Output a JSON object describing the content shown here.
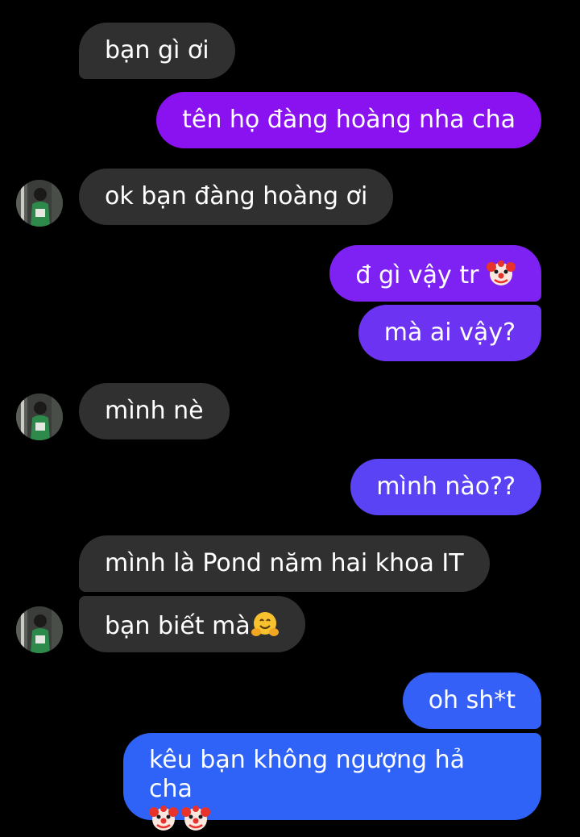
{
  "conversation": {
    "messages": [
      {
        "from": "them",
        "text": "bạn gì ơi"
      },
      {
        "from": "me",
        "text": "tên họ đàng hoàng nha cha",
        "color": "#8a12f0"
      },
      {
        "from": "them",
        "text": "ok bạn đàng hoàng ơi"
      },
      {
        "from": "me",
        "text": "đ gì vậy tr",
        "emoji": "clown-face",
        "color": "#7d22f2"
      },
      {
        "from": "me",
        "text": "mà ai vậy?",
        "color": "#6d33f3"
      },
      {
        "from": "them",
        "text": "mình nè"
      },
      {
        "from": "me",
        "text": "mình nào??",
        "color": "#5a43f5"
      },
      {
        "from": "them",
        "text": "mình là Pond năm hai khoa IT"
      },
      {
        "from": "them",
        "text": "bạn biết mà",
        "emoji": "hugging-face"
      },
      {
        "from": "me",
        "text": "oh sh*t",
        "color": "#3560f8"
      },
      {
        "from": "me",
        "text": "kêu bạn không ngượng hả cha",
        "emoji": "clown-face x2",
        "color": "#2f63f8"
      }
    ]
  },
  "colors": {
    "background": "#000000",
    "incoming_bubble": "#303030",
    "text": "#ffffff"
  }
}
